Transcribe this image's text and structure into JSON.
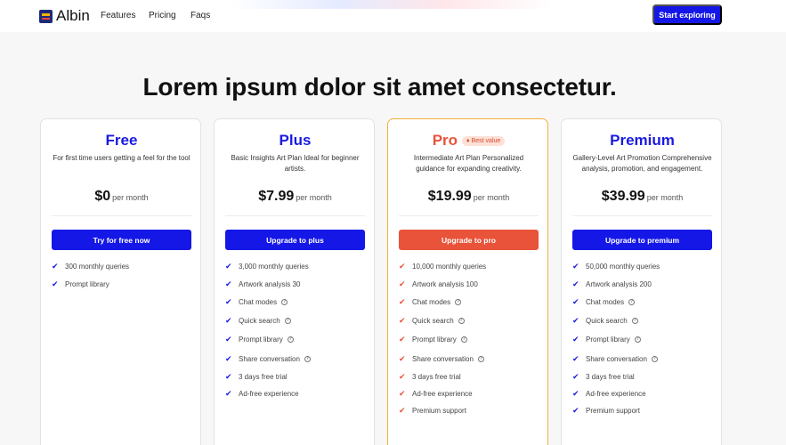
{
  "brand": {
    "name": "Albin"
  },
  "nav": {
    "items": [
      "Features",
      "Pricing",
      "Faqs"
    ],
    "cta": "Start exploring"
  },
  "headline": "Lorem ipsum dolor sit amet consectetur.",
  "plans": [
    {
      "title": "Free",
      "desc": "For first time users getting a feel for the tool",
      "price": "$0",
      "per": "per month",
      "button": "Try for free now",
      "features": [
        {
          "text": "300 monthly queries",
          "info": false
        },
        {
          "text": "Prompt library",
          "info": false
        }
      ]
    },
    {
      "title": "Plus",
      "desc": "Basic Insights Art Plan Ideal for beginner artists.",
      "price": "$7.99",
      "per": "per month",
      "button": "Upgrade to plus",
      "features": [
        {
          "text": "3,000 monthly queries",
          "info": false
        },
        {
          "text": "Artwork analysis 30",
          "info": false
        },
        {
          "text": "Chat modes",
          "info": true
        },
        {
          "text": "Quick search",
          "info": true
        },
        {
          "text": "Prompt library",
          "info": true
        },
        {
          "text": "Share conversation",
          "info": true
        },
        {
          "text": "3 days free trial",
          "info": false
        },
        {
          "text": "Ad-free experience",
          "info": false
        }
      ]
    },
    {
      "title": "Pro",
      "badge": "Best value",
      "desc": "Intermediate Art Plan Personalized guidance for expanding creativity.",
      "price": "$19.99",
      "per": "per month",
      "button": "Upgrade to pro",
      "features": [
        {
          "text": "10,000 monthly queries",
          "info": false
        },
        {
          "text": "Artwork analysis 100",
          "info": false
        },
        {
          "text": "Chat modes",
          "info": true
        },
        {
          "text": "Quick search",
          "info": true
        },
        {
          "text": "Prompt library",
          "info": true
        },
        {
          "text": "Share conversation",
          "info": true
        },
        {
          "text": "3 days free trial",
          "info": false
        },
        {
          "text": "Ad-free experience",
          "info": false
        },
        {
          "text": "Premium support",
          "info": false
        }
      ]
    },
    {
      "title": "Premium",
      "desc": "Gallery-Level Art Promotion Comprehensive analysis, promotion, and engagement.",
      "price": "$39.99",
      "per": "per month",
      "button": "Upgrade to premium",
      "features": [
        {
          "text": "50,000 monthly queries",
          "info": false
        },
        {
          "text": "Artwork analysis 200",
          "info": false
        },
        {
          "text": "Chat modes",
          "info": true
        },
        {
          "text": "Quick search",
          "info": true
        },
        {
          "text": "Prompt library",
          "info": true
        },
        {
          "text": "Share conversation",
          "info": true
        },
        {
          "text": "3 days free trial",
          "info": false
        },
        {
          "text": "Ad-free experience",
          "info": false
        },
        {
          "text": "Premium support",
          "info": false
        }
      ]
    }
  ],
  "colors": {
    "primary": "#1417e6",
    "accent": "#e8533a",
    "badge_bg": "#fde0d6",
    "pro_border": "#f0b23a"
  }
}
